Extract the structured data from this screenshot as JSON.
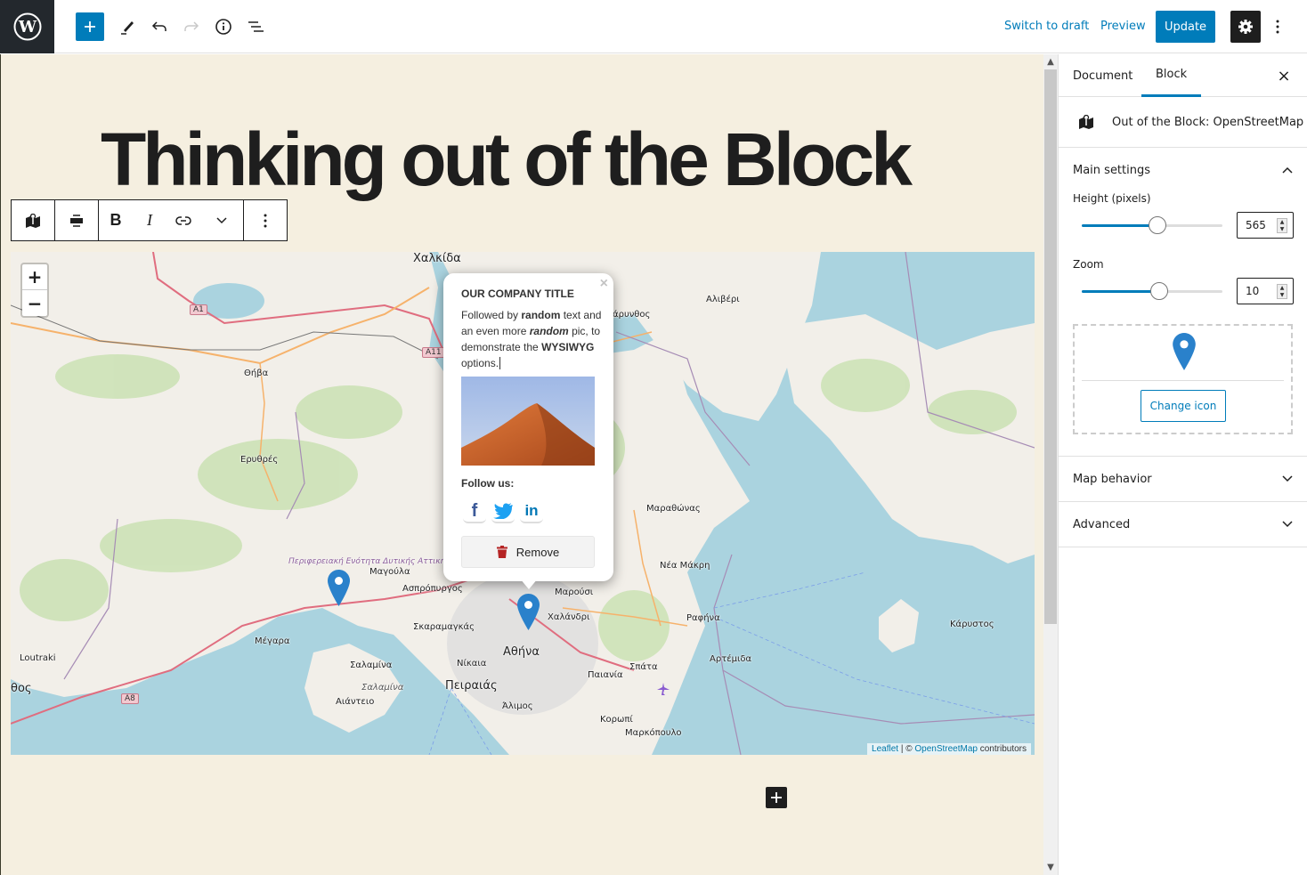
{
  "topbar": {
    "logo": "wordpress-logo",
    "add_block_icon": "plus-icon",
    "tools_icon": "pencil-icon",
    "undo_icon": "undo-icon",
    "redo_icon": "redo-icon",
    "info_icon": "info-icon",
    "outline_icon": "list-view-icon",
    "switch_to_draft": "Switch to draft",
    "preview": "Preview",
    "update": "Update",
    "settings_icon": "gear-icon",
    "more_icon": "more-vertical-icon"
  },
  "editor": {
    "post_title": "Thinking out of the Block",
    "block_toolbar": {
      "items": [
        {
          "name": "block-type-map",
          "icon": "map-icon"
        },
        {
          "name": "align",
          "icon": "align-center-icon"
        },
        {
          "name": "bold",
          "label": "B"
        },
        {
          "name": "italic",
          "label": "I"
        },
        {
          "name": "link",
          "icon": "link-icon"
        },
        {
          "name": "more-rich-text",
          "icon": "chevron-down-icon"
        },
        {
          "name": "block-options",
          "icon": "more-vertical-icon"
        }
      ]
    },
    "map": {
      "zoom_in": "+",
      "zoom_out": "−",
      "attribution_leaflet": "Leaflet",
      "attribution_sep": " | © ",
      "attribution_osm": "OpenStreetMap",
      "attribution_suffix": " contributors",
      "labels": [
        {
          "text": "Χαλκίδα",
          "cls": "big"
        },
        {
          "text": "Αλιβέρι",
          "cls": ""
        },
        {
          "text": "άρυνθος",
          "cls": ""
        },
        {
          "text": "Θήβα",
          "cls": ""
        },
        {
          "text": "Ερυθρές",
          "cls": ""
        },
        {
          "text": "Μαραθώνας",
          "cls": ""
        },
        {
          "text": "Νέα Μάκρη",
          "cls": ""
        },
        {
          "text": "Μαγούλα",
          "cls": ""
        },
        {
          "text": "Ασπρόπυργος",
          "cls": ""
        },
        {
          "text": "Μαρούσι",
          "cls": ""
        },
        {
          "text": "Χαλάνδρι",
          "cls": ""
        },
        {
          "text": "Ραφήνα",
          "cls": ""
        },
        {
          "text": "Κάρυστος",
          "cls": ""
        },
        {
          "text": "Μέγαρα",
          "cls": ""
        },
        {
          "text": "Σκαραμαγκάς",
          "cls": ""
        },
        {
          "text": "Αθήνα",
          "cls": "big"
        },
        {
          "text": "Loutraki",
          "cls": ""
        },
        {
          "text": "Σαλαμίνα",
          "cls": ""
        },
        {
          "text": "Νίκαια",
          "cls": ""
        },
        {
          "text": "Σπάτα",
          "cls": ""
        },
        {
          "text": "Αρτέμιδα",
          "cls": ""
        },
        {
          "text": "θος",
          "cls": "big"
        },
        {
          "text": "Σαλαμίνα",
          "cls": "italic"
        },
        {
          "text": "Πειραιάς",
          "cls": "big"
        },
        {
          "text": "Παιανία",
          "cls": ""
        },
        {
          "text": "Αιάντειο",
          "cls": ""
        },
        {
          "text": "Άλιμος",
          "cls": ""
        },
        {
          "text": "Κορωπί",
          "cls": ""
        },
        {
          "text": "Μαρκόπουλο",
          "cls": ""
        }
      ],
      "region_label": "Περιφερειακή Ενότητα Δυτικής Αττικής",
      "road_shields": [
        "A1",
        "A11",
        "A8"
      ],
      "popup": {
        "title": "OUR COMPANY TITLE",
        "body_1": "Followed by ",
        "body_bold_1": "random",
        "body_2": " text and an even more ",
        "body_bold_italic": "random",
        "body_3": " pic, to demonstrate the ",
        "body_bold_2": "WYSIWYG",
        "body_4": " options.",
        "image_alt": "desert-dune-photo",
        "follow_label": "Follow us:",
        "social": [
          {
            "name": "facebook",
            "glyph": "f",
            "color": "#3b5998"
          },
          {
            "name": "twitter",
            "glyph": "🐦",
            "color": "#1da1f2"
          },
          {
            "name": "linkedin",
            "glyph": "in",
            "color": "#0077b5"
          }
        ],
        "remove_label": "Remove",
        "close": "×"
      }
    }
  },
  "sidebar": {
    "tabs": [
      {
        "label": "Document",
        "active": false
      },
      {
        "label": "Block",
        "active": true
      }
    ],
    "close": "×",
    "block_name": "Out of the Block: OpenStreetMap",
    "main_settings": {
      "title": "Main settings",
      "height_label": "Height (pixels)",
      "height_value": "565",
      "height_fraction": 0.54,
      "zoom_label": "Zoom",
      "zoom_value": "10",
      "zoom_fraction": 0.55,
      "change_icon": "Change icon"
    },
    "panels": [
      {
        "title": "Map behavior"
      },
      {
        "title": "Advanced"
      }
    ]
  },
  "colors": {
    "accent": "#007cba",
    "editor_bg": "#f5efe0",
    "marker": "#2a81cb",
    "dark": "#1e1e1e"
  }
}
